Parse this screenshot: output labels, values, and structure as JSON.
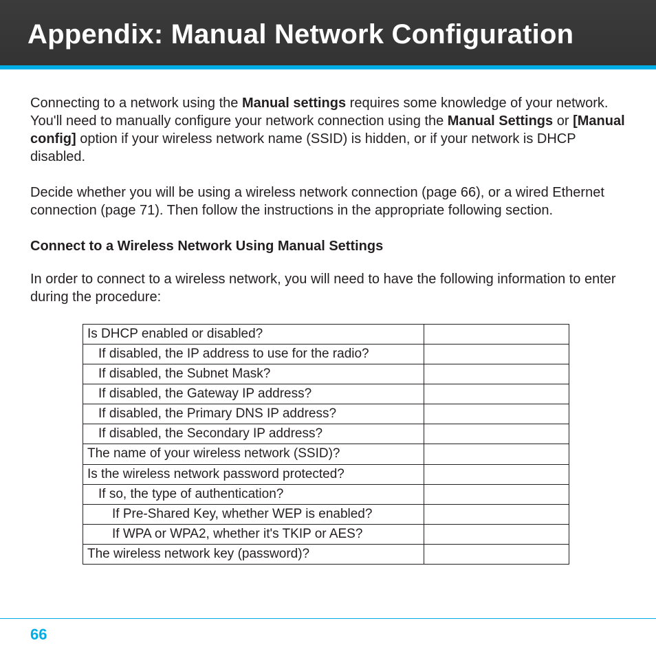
{
  "header": {
    "title": "Appendix: Manual Network Configuration"
  },
  "body": {
    "para1_part1": "Connecting to a network using the ",
    "para1_bold1": "Manual settings",
    "para1_part2": " requires some knowledge of your network. You'll need to manually configure your network connection using the ",
    "para1_bold2": "Manual Settings",
    "para1_part3": " or ",
    "para1_bold3": "[Manual config]",
    "para1_part4": " option if your wireless network name (SSID) is hidden, or if your network is DHCP disabled.",
    "para2": "Decide whether you will be using a wireless network connection (page 66), or a wired Ethernet connection (page 71). Then follow the instructions in the appropriate following section.",
    "section_heading": "Connect to a Wireless Network Using Manual Settings",
    "para3": "In order to connect to a wireless network, you will need to have the following information to enter during the procedure:"
  },
  "table": {
    "r1a": "Is DHCP enabled or disabled?",
    "r1b": "If disabled, the IP address to use for the radio?",
    "r1c": "If disabled, the Subnet Mask?",
    "r1d": "If disabled, the Gateway IP address?",
    "r1e": "If disabled, the Primary DNS IP address?",
    "r1f": "If disabled, the Secondary IP address?",
    "r2": "The name of your wireless network (SSID)?",
    "r3a": "Is the wireless network password protected?",
    "r3b": "If so, the type of authentication?",
    "r3c": "If Pre-Shared Key, whether WEP is enabled?",
    "r3d": "If WPA or WPA2, whether it's TKIP or AES?",
    "r4": "The wireless network key (password)?"
  },
  "footer": {
    "page": "66"
  }
}
